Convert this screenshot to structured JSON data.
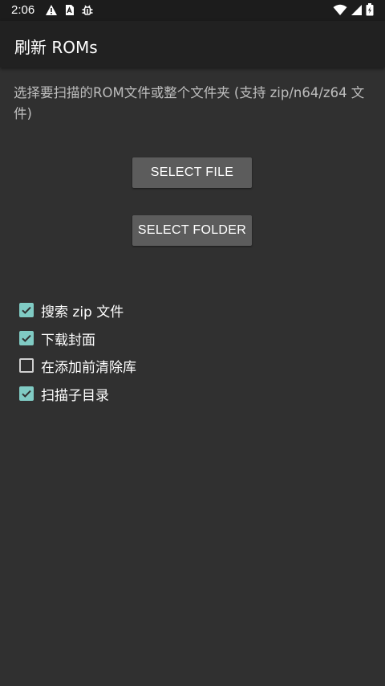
{
  "status_bar": {
    "time": "2:06",
    "left_icons": [
      "warning-icon",
      "sim-card-icon",
      "debug-bug-icon"
    ],
    "right_icons": [
      "wifi-icon",
      "cell-signal-icon",
      "battery-charging-icon"
    ]
  },
  "app_bar": {
    "title": "刷新 ROMs"
  },
  "main": {
    "description": "选择要扫描的ROM文件或整个文件夹 (支持 zip/n64/z64 文件)",
    "select_file_label": "SELECT FILE",
    "select_folder_label": "SELECT FOLDER",
    "options": [
      {
        "label": "搜索 zip 文件",
        "checked": true
      },
      {
        "label": "下载封面",
        "checked": true
      },
      {
        "label": "在添加前清除库",
        "checked": false
      },
      {
        "label": "扫描子目录",
        "checked": true
      }
    ]
  },
  "colors": {
    "background": "#303030",
    "app_bar": "#212121",
    "status_bar": "#1c1c1c",
    "button": "#5c5c5c",
    "accent": "#80cbc4",
    "description_text": "#bdbdbd"
  }
}
